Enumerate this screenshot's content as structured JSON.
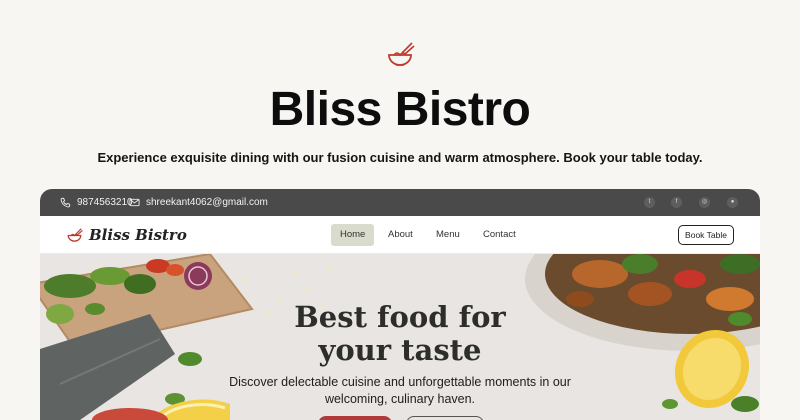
{
  "brand": {
    "title": "Bliss Bistro",
    "tagline": "Experience exquisite dining with our fusion cuisine and warm atmosphere. Book your table today.",
    "accent": "#c0392b"
  },
  "preview": {
    "topbar": {
      "phone": "9874563210",
      "email": "shreekant4062@gmail.com",
      "socials": [
        "twitter-icon",
        "facebook-icon",
        "instagram-icon",
        "github-icon"
      ]
    },
    "nav": {
      "brand": "Bliss Bistro",
      "links": [
        "Home",
        "About",
        "Menu",
        "Contact"
      ],
      "active": "Home",
      "cta": "Book Table"
    },
    "hero": {
      "title_line1": "Best food for",
      "title_line2": "your taste",
      "sub_line1": "Discover delectable cuisine and unforgettable moments in our",
      "sub_line2": "welcoming, culinary haven."
    }
  }
}
